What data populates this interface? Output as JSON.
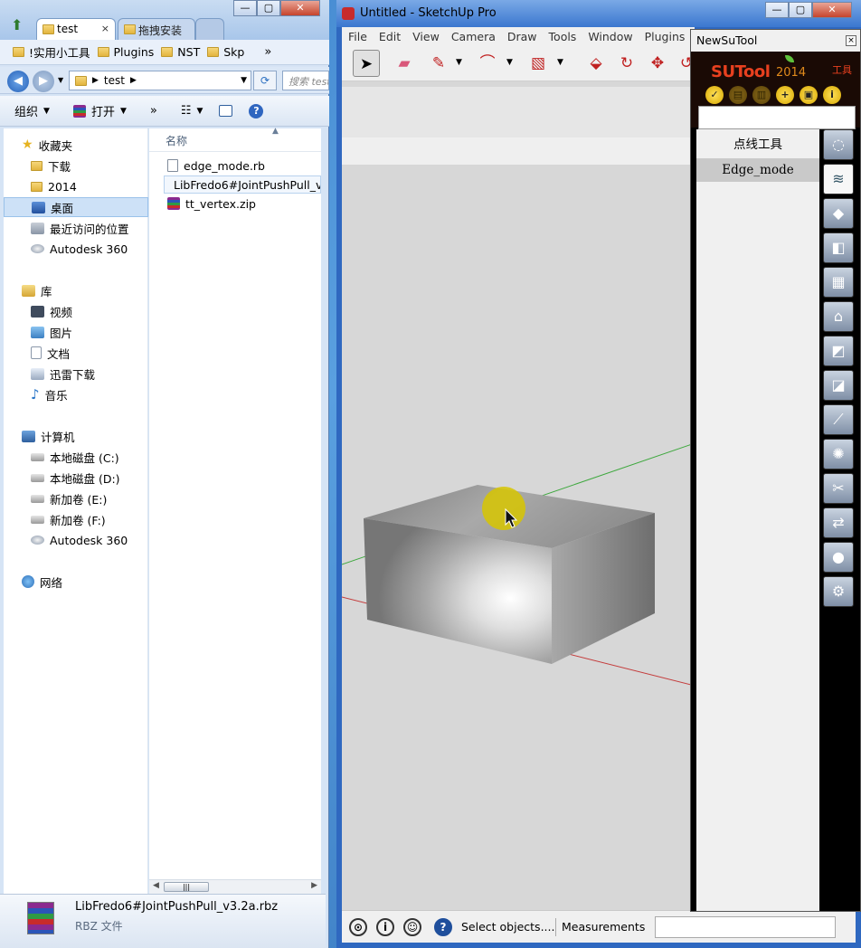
{
  "explorer": {
    "tabs": [
      {
        "label": "test",
        "close": "×"
      },
      {
        "label": "拖拽安装"
      }
    ],
    "window_buttons": {
      "minimize": "—",
      "restore": "▢",
      "close": "✕"
    },
    "favorites_bar": {
      "items": [
        "!实用小工具",
        "Plugins",
        "NST",
        "Skp"
      ],
      "more": "»"
    },
    "address": {
      "path": "test",
      "search_placeholder": "搜索 test",
      "refresh": "⟳"
    },
    "command_bar": {
      "organize": "组织",
      "open": "打开",
      "more": "»"
    },
    "nav": {
      "favorites_label": "收藏夹",
      "favorites": [
        "下载",
        "2014",
        "桌面",
        "最近访问的位置",
        "Autodesk 360"
      ],
      "library_label": "库",
      "libraries": [
        "视频",
        "图片",
        "文档",
        "迅雷下载",
        "音乐"
      ],
      "computer_label": "计算机",
      "drives": [
        "本地磁盘 (C:)",
        "本地磁盘 (D:)",
        "新加卷 (E:)",
        "新加卷 (F:)",
        "Autodesk 360"
      ],
      "network_label": "网络"
    },
    "files": {
      "column_name": "名称",
      "items": [
        "edge_mode.rb",
        "LibFredo6#JointPushPull_v3.2a.rbz",
        "tt_vertex.zip"
      ]
    },
    "details": {
      "name": "LibFredo6#JointPushPull_v3.2a.rbz",
      "type": "RBZ 文件"
    }
  },
  "sketchup": {
    "title": "Untitled - SketchUp Pro",
    "window_buttons": {
      "minimize": "—",
      "restore": "▢",
      "close": "✕"
    },
    "menu": [
      "File",
      "Edit",
      "View",
      "Camera",
      "Draw",
      "Tools",
      "Window",
      "Plugins"
    ],
    "status": {
      "text": "Select objects....",
      "measurements_label": "Measurements",
      "measurements_value": ""
    }
  },
  "newsutool": {
    "title": "NewSuTool",
    "close": "×",
    "brand": "SUTool",
    "year": "2014",
    "tools_label": "工具",
    "list": [
      "点线工具",
      "Edge_mode"
    ],
    "input_value": ""
  }
}
